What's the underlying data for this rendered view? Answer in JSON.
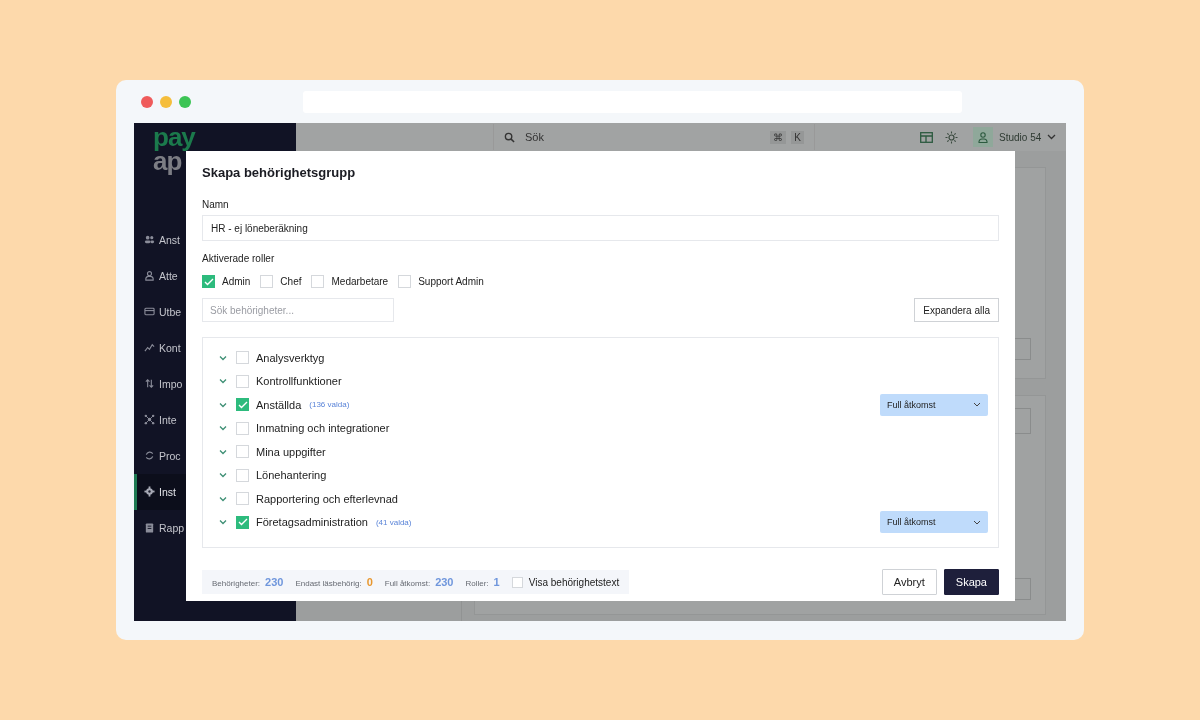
{
  "logo": {
    "top": "pay",
    "bottom": "ap"
  },
  "sidebar": {
    "items": [
      {
        "label": "Anst",
        "kind": "people",
        "selected": false
      },
      {
        "label": "Atte",
        "kind": "person",
        "selected": false
      },
      {
        "label": "Utbe",
        "kind": "card",
        "selected": false
      },
      {
        "label": "Kont",
        "kind": "chart",
        "selected": false
      },
      {
        "label": "Impo",
        "kind": "import",
        "selected": false
      },
      {
        "label": "Inte",
        "kind": "network",
        "selected": false
      },
      {
        "label": "Proc",
        "kind": "refresh",
        "selected": false
      },
      {
        "label": "Inst",
        "kind": "gear",
        "selected": true
      },
      {
        "label": "Rapp",
        "kind": "clipboard",
        "selected": false
      }
    ]
  },
  "topbar": {
    "search": "Sök",
    "shortcut": [
      "⌘",
      "K"
    ],
    "user": "Studio 54"
  },
  "dialog": {
    "title": "Skapa behörighetsgrupp",
    "name_label": "Namn",
    "name_value": "HR - ej löneberäkning",
    "roles_label": "Aktiverade roller",
    "roles": [
      {
        "label": "Admin",
        "checked": true
      },
      {
        "label": "Chef",
        "checked": false
      },
      {
        "label": "Medarbetare",
        "checked": false
      },
      {
        "label": "Support Admin",
        "checked": false
      }
    ],
    "search": {
      "placeholder": "Sök behörigheter..."
    },
    "expand_button": "Expandera alla",
    "permissions": [
      {
        "label": "Analysverktyg",
        "checked": false
      },
      {
        "label": "Kontrollfunktioner",
        "checked": false
      },
      {
        "label": "Anställda",
        "checked": true,
        "count": "(136 valda)",
        "access": "Full åtkomst"
      },
      {
        "label": "Inmatning och integrationer",
        "checked": false
      },
      {
        "label": "Mina uppgifter",
        "checked": false
      },
      {
        "label": "Lönehantering",
        "checked": false
      },
      {
        "label": "Rapportering och efterlevnad",
        "checked": false
      },
      {
        "label": "Företagsadministration",
        "checked": true,
        "count": "(41 valda)",
        "access": "Full åtkomst"
      }
    ],
    "stats": [
      {
        "label": "Behörigheter:",
        "value": "230",
        "color": "#6f96dc"
      },
      {
        "label": "Endast läsbehörig:",
        "value": "0",
        "color": "#e8972e"
      },
      {
        "label": "Full åtkomst:",
        "value": "230",
        "color": "#6f96dc"
      },
      {
        "label": "Roller:",
        "value": "1",
        "color": "#6f96dc"
      }
    ],
    "show_text": {
      "label": "Visa behörighetstext",
      "checked": false
    },
    "buttons": {
      "cancel": "Avbryt",
      "submit": "Skapa"
    }
  }
}
